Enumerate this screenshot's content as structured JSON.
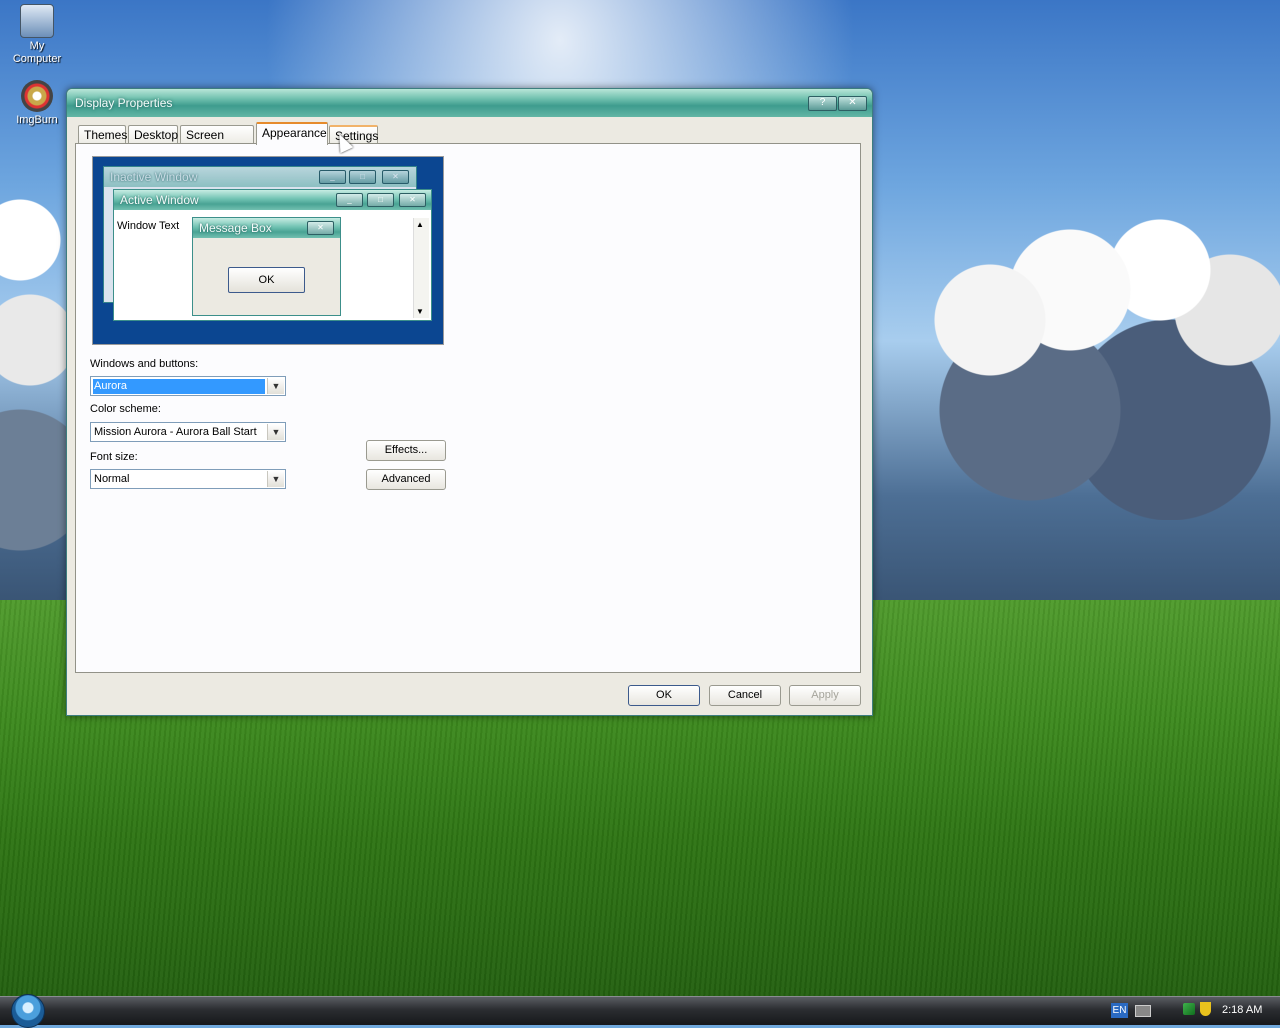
{
  "desktop": {
    "icons": [
      {
        "label_line1": "My",
        "label_line2": "Computer"
      },
      {
        "label_line1": "ImgBurn"
      }
    ]
  },
  "window": {
    "title": "Display Properties",
    "help_symbol": "?",
    "close_symbol": "✕",
    "tabs": [
      "Themes",
      "Desktop",
      "Screen Saver",
      "Appearance",
      "Settings"
    ],
    "active_tab": "Appearance",
    "preview": {
      "inactive_title": "Inactive Window",
      "active_title": "Active Window",
      "window_text": "Window Text",
      "message_box_title": "Message Box",
      "message_box_ok": "OK"
    },
    "windows_and_buttons": {
      "label": "Windows and buttons:",
      "value": "Aurora"
    },
    "color_scheme": {
      "label": "Color scheme:",
      "value": "Mission Aurora - Aurora Ball Start"
    },
    "font_size": {
      "label": "Font size:",
      "value": "Normal"
    },
    "effects_label": "Effects...",
    "advanced_label": "Advanced",
    "ok_label": "OK",
    "cancel_label": "Cancel",
    "apply_label": "Apply"
  },
  "taskbar": {
    "language": "EN",
    "clock": "2:18 AM"
  }
}
